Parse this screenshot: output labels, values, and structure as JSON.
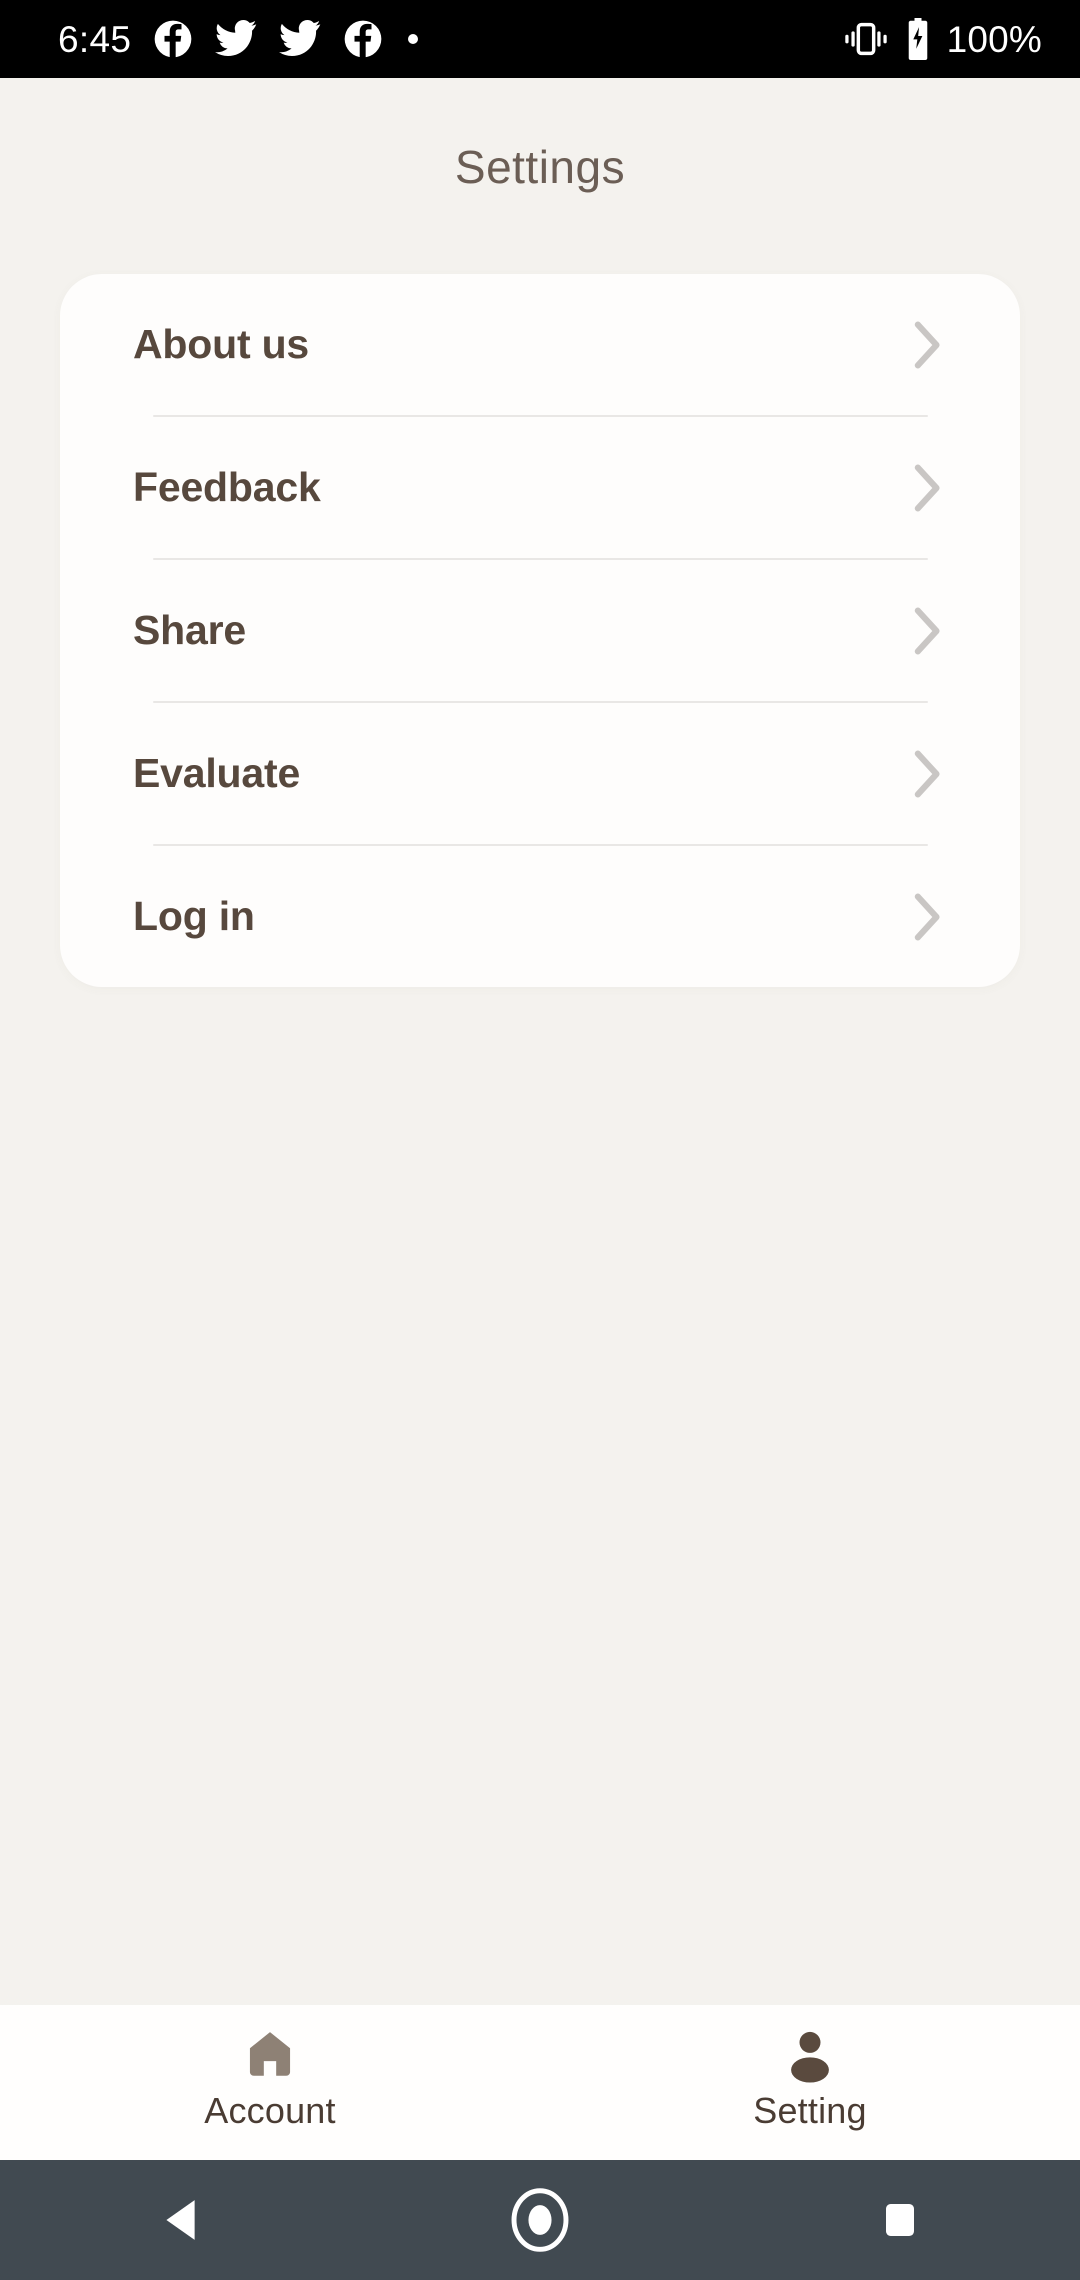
{
  "status_bar": {
    "time": "6:45",
    "battery_percent": "100%",
    "left_icons": [
      "facebook-icon",
      "twitter-icon",
      "twitter-icon",
      "facebook-icon",
      "dot-icon"
    ],
    "right_icons": [
      "vibrate-icon",
      "battery-charging-icon"
    ],
    "background_color": "#000000",
    "text_color": "#ffffff"
  },
  "header": {
    "title": "Settings",
    "title_color": "#6b5e55"
  },
  "theme": {
    "page_background": "#f4f2ee",
    "card_background": "#fefdfc",
    "label_color": "#57483d",
    "chevron_color": "#c9c6c4",
    "divider_color": "#e9e7e5",
    "tab_active_color": "#5a4a3e",
    "tab_inactive_color": "#8e8175",
    "nav_bar_background": "#414a51"
  },
  "settings_menu": {
    "items": [
      {
        "label": "About us",
        "icon": "chevron-right-icon"
      },
      {
        "label": "Feedback",
        "icon": "chevron-right-icon"
      },
      {
        "label": "Share",
        "icon": "chevron-right-icon"
      },
      {
        "label": "Evaluate",
        "icon": "chevron-right-icon"
      },
      {
        "label": "Log in",
        "icon": "chevron-right-icon"
      }
    ]
  },
  "tab_bar": {
    "items": [
      {
        "label": "Account",
        "icon": "home-icon",
        "active": false,
        "color": "#8e8175"
      },
      {
        "label": "Setting",
        "icon": "person-icon",
        "active": true,
        "color": "#5a4a3e"
      }
    ]
  },
  "android_nav": {
    "back": "back-triangle-icon",
    "home": "home-circle-icon",
    "recents": "recents-square-icon",
    "icon_color": "#ffffff"
  }
}
